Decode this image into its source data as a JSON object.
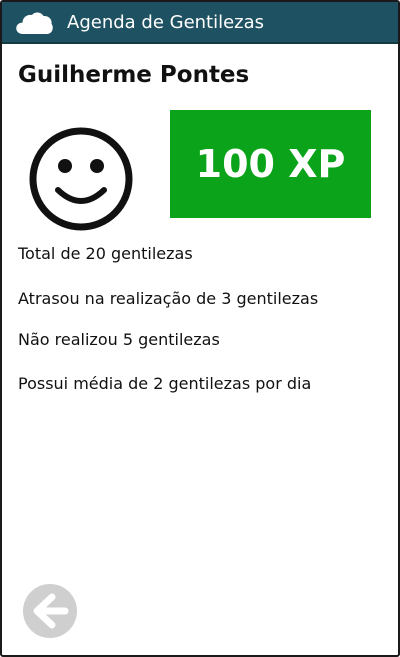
{
  "header": {
    "title": "Agenda de Gentilezas",
    "icon": "cloud-icon"
  },
  "profile": {
    "name": "Guilherme Pontes",
    "avatar_icon": "smiley-icon",
    "xp_label": "100 XP",
    "xp_color": "#0ba31a"
  },
  "stats": [
    "Total de 20 gentilezas",
    "Atrasou na realização de 3 gentilezas",
    "Não realizou 5 gentilezas",
    "Possui média de 2 gentilezas por dia"
  ],
  "footer": {
    "back_icon": "arrow-left-circle-icon"
  },
  "colors": {
    "header_bg": "#1e5161",
    "back_button": "#cfcfcf"
  }
}
